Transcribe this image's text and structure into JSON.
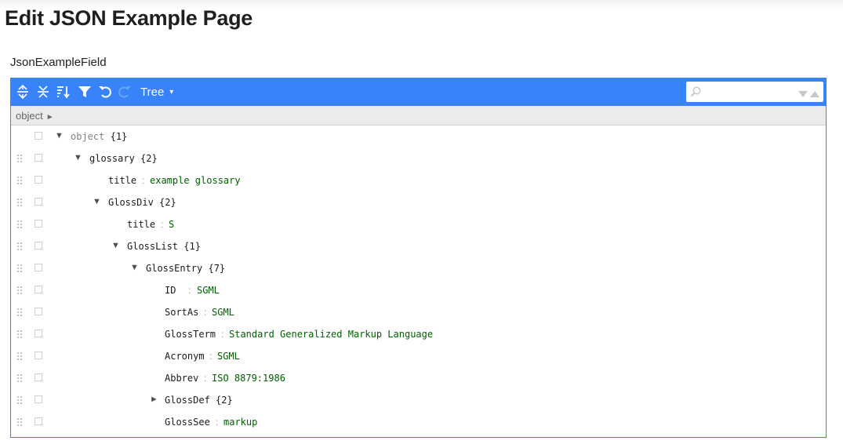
{
  "page": {
    "title": "Edit JSON Example Page",
    "field_label": "JsonExampleField"
  },
  "toolbar": {
    "icons": [
      "expand-all-icon",
      "collapse-all-icon",
      "sort-icon",
      "filter-icon",
      "undo-icon",
      "redo-icon"
    ],
    "mode_label": "Tree",
    "mode_caret": "▾",
    "search_placeholder": "",
    "search_next": "▼",
    "search_prev": "▲"
  },
  "navbar": {
    "crumb": "object",
    "crumb_arrow": "►"
  },
  "colors": {
    "accent": "#3883fa",
    "string_value": "#006000",
    "navbar_bg": "#ebebeb"
  },
  "tree": {
    "root": {
      "label": "object",
      "count": "{1}",
      "expander": "▼"
    },
    "glossary": {
      "label": "glossary",
      "count": "{2}",
      "expander": "▼"
    },
    "glossary_title": {
      "label": "title",
      "sep": ":",
      "value": "example glossary"
    },
    "glossdiv": {
      "label": "GlossDiv",
      "count": "{2}",
      "expander": "▼"
    },
    "glossdiv_title": {
      "label": "title",
      "sep": ":",
      "value": "S"
    },
    "glosslist": {
      "label": "GlossList",
      "count": "{1}",
      "expander": "▼"
    },
    "glossentry": {
      "label": "GlossEntry",
      "count": "{7}",
      "expander": "▼"
    },
    "id": {
      "label": "ID",
      "sep": ":",
      "value": "SGML"
    },
    "sortas": {
      "label": "SortAs",
      "sep": ":",
      "value": "SGML"
    },
    "glossterm": {
      "label": "GlossTerm",
      "sep": ":",
      "value": "Standard Generalized Markup Language"
    },
    "acronym": {
      "label": "Acronym",
      "sep": ":",
      "value": "SGML"
    },
    "abbrev": {
      "label": "Abbrev",
      "sep": ":",
      "value": "ISO 8879:1986"
    },
    "glossdef": {
      "label": "GlossDef",
      "count": "{2}",
      "expander": "►"
    },
    "glosssee": {
      "label": "GlossSee",
      "sep": ":",
      "value": "markup"
    }
  }
}
